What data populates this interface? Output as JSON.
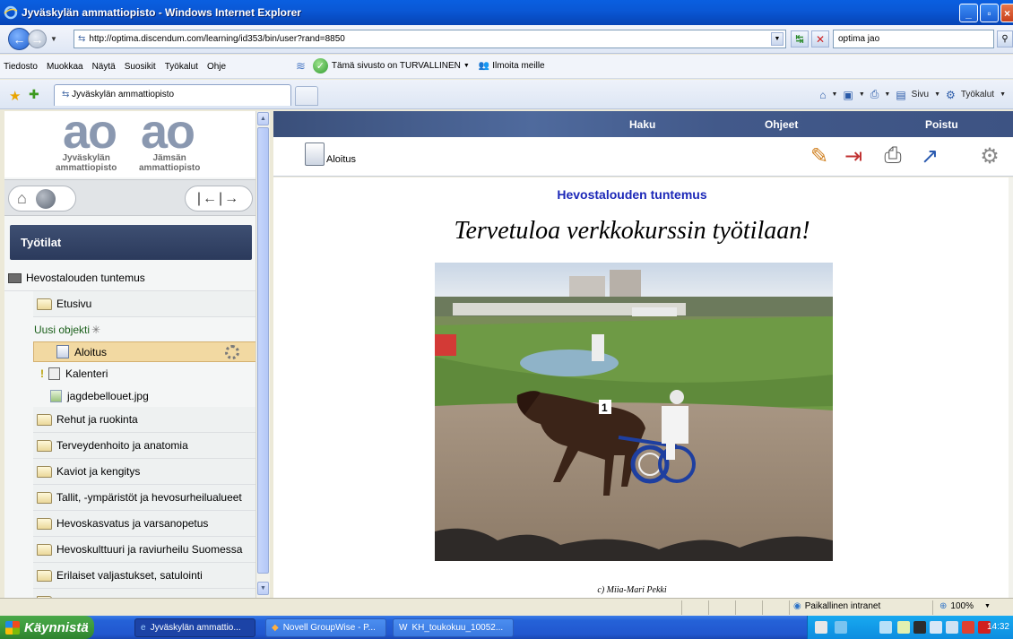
{
  "window": {
    "title": "Jyväskylän ammattiopisto - Windows Internet Explorer"
  },
  "address": {
    "url": "http://optima.discendum.com/learning/id353/bin/user?rand=8850",
    "search": "optima jao"
  },
  "menu": [
    "Tiedosto",
    "Muokkaa",
    "Näytä",
    "Suosikit",
    "Työkalut",
    "Ohje"
  ],
  "phishing": {
    "status": "Tämä sivusto on TURVALLINEN",
    "report": "Ilmoita meille"
  },
  "tab": {
    "title": "Jyväskylän ammattiopisto"
  },
  "commands": {
    "page": "Sivu",
    "tools": "Työkalut"
  },
  "logo": {
    "left": {
      "mark": "ao",
      "line1": "Jyväskylän",
      "line2": "ammattiopisto"
    },
    "right": {
      "mark": "ao",
      "line1": "Jämsän",
      "line2": "ammattiopisto"
    }
  },
  "workspaces": "Työtilat",
  "tree": {
    "root": "Hevostalouden tuntemus",
    "etusivu": "Etusivu",
    "new_object": "Uusi objekti",
    "aloitus": "Aloitus",
    "kalenteri": "Kalenteri",
    "image_file": "jagdebellouet.jpg",
    "folders": [
      "Rehut ja ruokinta",
      "Terveydenhoito ja anatomia",
      "Kaviot ja kengitys",
      "Tallit, -ympäristöt ja hevosurheilualueet",
      "Hevoskasvatus ja varsanopetus",
      "Hevoskulttuuri ja raviurheilu Suomessa",
      "Erilaiset valjastukset, satulointi"
    ]
  },
  "topnav": {
    "haku": "Haku",
    "ohjeet": "Ohjeet",
    "poistu": "Poistu"
  },
  "toolbar": {
    "page_title": "Aloitus"
  },
  "content": {
    "course_title": "Hevostalouden tuntemus",
    "welcome": "Tervetuloa verkkokurssin työtilaan!",
    "caption": "c) Miia-Mari Pekki",
    "bib_number": "1"
  },
  "status": {
    "zone": "Paikallinen intranet",
    "zoom": "100%"
  },
  "taskbar": {
    "start": "Käynnistä",
    "items": [
      "Jyväskylän ammattio...",
      "Novell GroupWise - P...",
      "KH_toukokuu_10052..."
    ],
    "clock": "14:32"
  }
}
